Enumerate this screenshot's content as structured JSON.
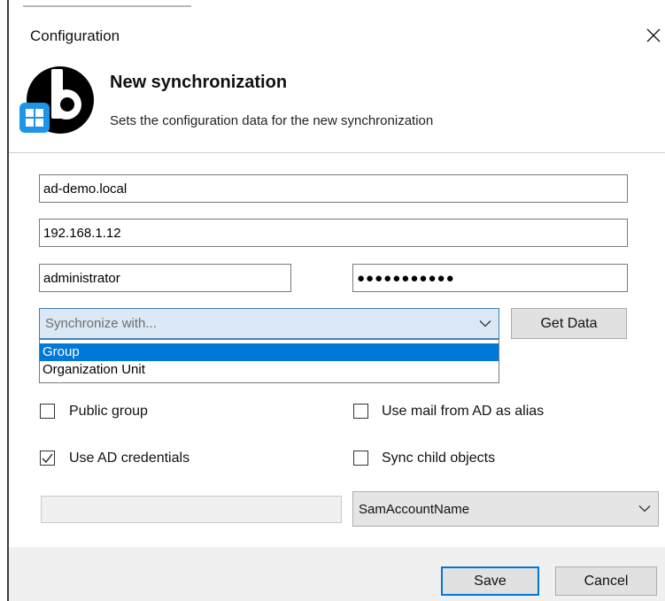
{
  "window": {
    "title": "Configuration"
  },
  "header": {
    "title": "New synchronization",
    "subtitle": "Sets the configuration data for the new synchronization",
    "logo_icon": "b-logo-with-windows-badge"
  },
  "form": {
    "domain_value": "ad-demo.local",
    "server_value": "192.168.1.12",
    "username_value": "administrator",
    "password_value": "●●●●●●●●●●●",
    "sync_with": {
      "placeholder": "Synchronize with...",
      "options": [
        "Group",
        "Organization Unit"
      ],
      "highlighted": "Group"
    },
    "get_data_label": "Get Data",
    "checkboxes": {
      "public_group": {
        "label": "Public group",
        "checked": false
      },
      "use_mail_alias": {
        "label": "Use mail from AD as alias",
        "checked": false
      },
      "use_ad_credentials": {
        "label": "Use AD credentials",
        "checked": true
      },
      "sync_child_objects": {
        "label": "Sync child objects",
        "checked": false
      }
    },
    "disabled_field_value": "",
    "account_attribute": "SamAccountName"
  },
  "footer": {
    "save_label": "Save",
    "cancel_label": "Cancel"
  },
  "colors": {
    "accent": "#0078d7",
    "focused_combo_bg": "#dbe8f5",
    "footer_bg": "#f0f0f0"
  }
}
